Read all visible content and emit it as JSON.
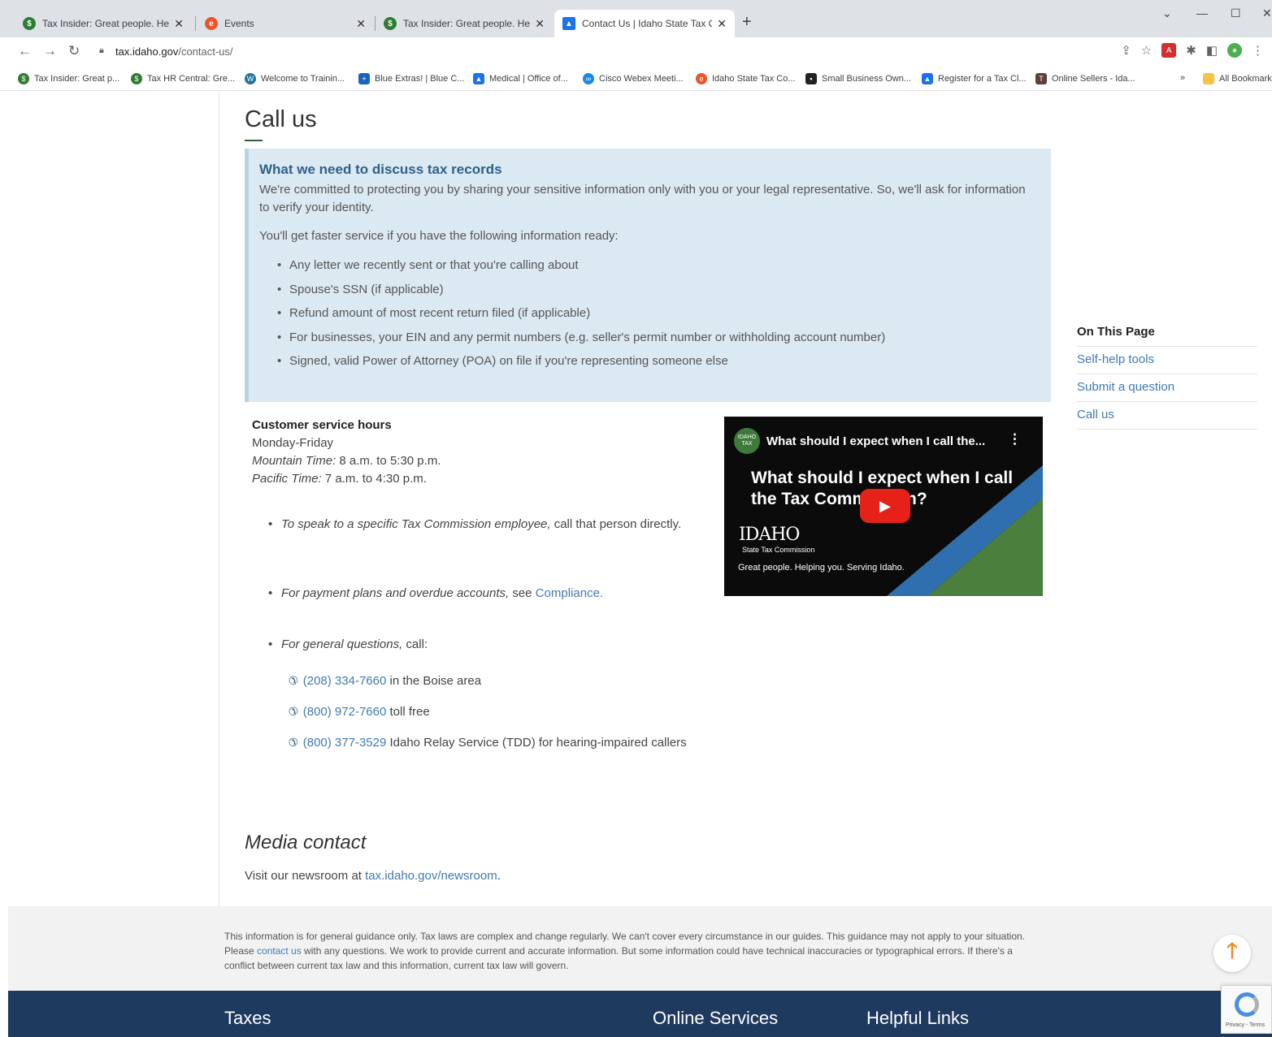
{
  "browser": {
    "tabs": [
      {
        "title": "Tax Insider: Great people. Helpin",
        "color": "#2e7d32"
      },
      {
        "title": "Events",
        "color": "#e8562a"
      },
      {
        "title": "Tax Insider: Great people. Helpin",
        "color": "#2e7d32"
      },
      {
        "title": "Contact Us | Idaho State Tax Con",
        "color": "#1a73e8"
      }
    ],
    "url_host": "tax.idaho.gov",
    "url_path": "/contact-us/",
    "bookmarks": [
      "Tax Insider: Great p...",
      "Tax HR Central: Gre...",
      "Welcome to Trainin...",
      "Blue Extras! | Blue C...",
      "Medical | Office of...",
      "Cisco Webex Meeti...",
      "Idaho State Tax Co...",
      "Small Business Own...",
      "Register for a Tax Cl...",
      "Online Sellers - Ida..."
    ],
    "bookmarks_overflow": "»",
    "all_bookmarks": "All Bookmarks"
  },
  "page": {
    "heading": "Call us",
    "info": {
      "title": "What we need to discuss tax records",
      "para1": "We're committed to protecting you by sharing your sensitive information only with you or your legal representative. So, we'll ask for information to verify your identity.",
      "para2": "You'll get faster service if you have the following information ready:",
      "items": [
        "Any letter we recently sent or that you're calling about",
        "Spouse's SSN (if applicable)",
        "Refund amount of most recent return filed (if applicable)",
        "For businesses, your EIN and any permit numbers (e.g. seller's permit number or withholding account number)",
        "Signed, valid Power of Attorney (POA) on file if you're representing someone else"
      ]
    },
    "hours": {
      "title": "Customer service hours",
      "days": "Monday-Friday",
      "mt_label": "Mountain Time:",
      "mt_value": " 8 a.m. to 5:30 p.m.",
      "pt_label": "Pacific Time:",
      "pt_value": " 7 a.m. to 4:30 p.m."
    },
    "bullets": {
      "b1_em": "To speak to a specific Tax Commission employee,",
      "b1_rest": " call that person directly.",
      "b2_em": "For payment plans and overdue accounts,",
      "b2_mid": " see ",
      "b2_link": "Compliance.",
      "b3_em": "For general questions,",
      "b3_rest": " call:"
    },
    "phones": [
      {
        "number": "(208) 334-7660",
        "desc": " in the Boise area"
      },
      {
        "number": "(800) 972-7660",
        "desc": " toll free"
      },
      {
        "number": "(800) 377-3529",
        "desc": "  Idaho Relay Service (TDD) for hearing-impaired callers"
      }
    ],
    "video": {
      "channel_logo": "IDAHO TAX",
      "title": "What should I expect when I call the...",
      "headline": "What should I expect when I call the Tax Commission?",
      "brand": "IDAHO",
      "brand_sub": "State Tax Commission",
      "tagline": "Great people. Helping you. Serving Idaho."
    },
    "on_this_page": {
      "title": "On This Page",
      "links": [
        "Self-help tools",
        "Submit a question",
        "Call us"
      ]
    },
    "media": {
      "heading": "Media contact",
      "text": "Visit our newsroom at ",
      "link": "tax.idaho.gov/newsroom",
      "end": "."
    },
    "disclaimer": {
      "part1": "This information is for general guidance only. Tax laws are complex and change regularly. We can't cover every circumstance in our guides. This guidance may not apply to your situation. Please ",
      "link": "contact us",
      "part2": " with any questions. We work to provide current and accurate information. But some information could have technical inaccuracies or typographical errors. If there's a conflict between current tax law and this information, current tax law will govern."
    },
    "footer": [
      "Taxes",
      "Online Services",
      "Helpful Links"
    ],
    "recaptcha_text": "Privacy - Terms"
  },
  "colors": {
    "link": "#3f7ab5",
    "info_bg": "#dbe9f2",
    "footer_bg": "#1f3a5f",
    "accent_orange": "#f08a24"
  }
}
